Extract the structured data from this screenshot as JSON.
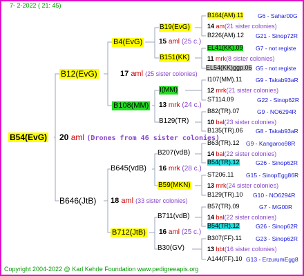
{
  "header": "7-   2-2022 (  21:  45)",
  "footer": "Copyright 2004-2022 @ Karl Kehrle Foundation     www.pedigreeapis.org",
  "root": {
    "label": "B54(EvG)",
    "count": "20",
    "type": "aml",
    "note": "(Drones from 46 sister colonies)"
  },
  "gen1": [
    {
      "label": "B12(EvG)",
      "count": "17",
      "type": "aml",
      "note": "(25 sister colonies)"
    },
    {
      "label": "B646(JtB)",
      "count": "18",
      "type": "aml",
      "note": "(33 sister colonies)"
    }
  ],
  "gen2": [
    {
      "label": "B4(EvG)",
      "count": "15",
      "type": "aml",
      "note": "(25 c.)"
    },
    {
      "label": "B108(MM)",
      "count": "13",
      "type": "mrk",
      "note": "(24 c.)"
    },
    {
      "label": "B645(vdB)",
      "count": "16",
      "type": "mrk",
      "note": "(28 c.)"
    },
    {
      "label": "B712(JtB)",
      "count": "16",
      "type": "aml",
      "note": "(25 c.)"
    }
  ],
  "gen3": [
    {
      "label": "B19(EvG)",
      "count": "14",
      "type": "am",
      "note": "(21 sister colonies)"
    },
    {
      "label": "B151(KK)",
      "count": "11",
      "type": "mrk",
      "note": "(8 sister colonies)"
    },
    {
      "label": "I(MM)",
      "count": "12",
      "type": "mrk",
      "note": "(21 sister colonies)"
    },
    {
      "label": "B129(TR)",
      "count": "10",
      "type": "bal",
      "note": "(23 sister colonies)"
    },
    {
      "label": "B207(vdB)",
      "count": "14",
      "type": "bal",
      "note": "(22 sister colonies)"
    },
    {
      "label": "B59(MKN)",
      "count": "13",
      "type": "mrk",
      "note": "(24 sister colonies)"
    },
    {
      "label": "B711(vdB)",
      "count": "14",
      "type": "bal",
      "note": "(22 sister colonies)"
    },
    {
      "label": "B30(GV)",
      "count": "13",
      "type": "hbt",
      "note": "(16 sister colonies)"
    }
  ],
  "gen4": [
    {
      "label": "B164(AM).11",
      "info": "G6 - Sahar00G"
    },
    {
      "label": "B226(AM).12",
      "info": "G21 - Sinop72R"
    },
    {
      "label": "EL41(KK).09",
      "info": "G7 - not registe"
    },
    {
      "label": "EL54(KK)ggp.06",
      "info": "G5 - not registe"
    },
    {
      "label": "I107(MM).11",
      "info": "G9 - Takab93aR"
    },
    {
      "label": "ST114.09",
      "info": "G22 - Sinop62R"
    },
    {
      "label": "B82(TR).07",
      "info": "G9 - NO6294R"
    },
    {
      "label": "B135(TR).06",
      "info": "G8 - Takab93aR"
    },
    {
      "label": "B63(TR).12",
      "info": "G9 - Kangaroo98R"
    },
    {
      "label": "B54(TR).12",
      "info": "G26 - Sinop62R"
    },
    {
      "label": "ST206.11",
      "info": "G15 - SinopEgg86R"
    },
    {
      "label": "B129(TR).10",
      "info": "G10 - NO6294R"
    },
    {
      "label": "B57(TR).09",
      "info": "G7 - MG00R"
    },
    {
      "label": "B54(TR).12",
      "info": "G26 - Sinop62R"
    },
    {
      "label": "B307(FF).11",
      "info": "G23 - Sinop62R"
    },
    {
      "label": "A144(FF).10",
      "info": "G13 - ErzurumEgg8"
    }
  ]
}
